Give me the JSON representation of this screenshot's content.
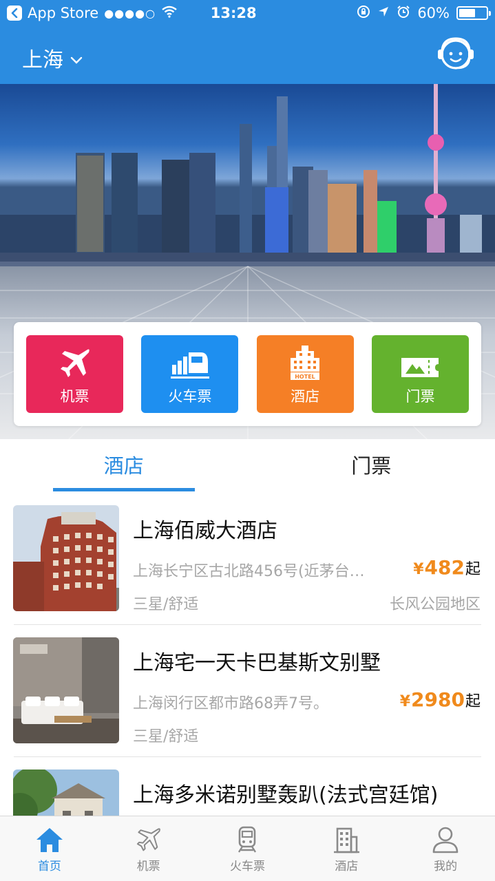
{
  "status_bar": {
    "carrier": "App Store",
    "signal_dots": "●●●●○",
    "time": "13:28",
    "battery_percent": "60%",
    "battery_level": 0.6
  },
  "header": {
    "city": "上海"
  },
  "colors": {
    "brand_blue": "#2b8ce0",
    "flight_tile": "#e8285a",
    "train_tile": "#1e8ff0",
    "hotel_tile": "#f57f26",
    "ticket_tile": "#64b22e",
    "price_orange": "#f08a1c"
  },
  "quick_entries": [
    {
      "label": "机票",
      "icon": "airplane-icon"
    },
    {
      "label": "火车票",
      "icon": "train-icon"
    },
    {
      "label": "酒店",
      "icon": "hotel-icon"
    },
    {
      "label": "门票",
      "icon": "ticket-icon"
    }
  ],
  "hero": {
    "hotel_sign_text": "HOTEL"
  },
  "tabs": [
    {
      "label": "酒店",
      "active": true
    },
    {
      "label": "门票",
      "active": false
    }
  ],
  "hotels": [
    {
      "name": "上海佰威大酒店",
      "address": "上海长宁区古北路456号(近茅台…",
      "price_symbol": "¥",
      "price": "482",
      "price_suffix": "起",
      "grade": "三星/舒适",
      "area": "长风公园地区"
    },
    {
      "name": "上海宅一天卡巴基斯文别墅",
      "address": "上海闵行区都市路68弄7号。",
      "price_symbol": "¥",
      "price": "2980",
      "price_suffix": "起",
      "grade": "三星/舒适",
      "area": ""
    },
    {
      "name": "上海多米诺别墅轰趴(法式宫廷馆)",
      "address": "",
      "price_symbol": "",
      "price": "",
      "price_suffix": "",
      "grade": "",
      "area": ""
    }
  ],
  "tabbar": [
    {
      "label": "首页",
      "icon": "home-icon",
      "active": true
    },
    {
      "label": "机票",
      "icon": "airplane-icon",
      "active": false
    },
    {
      "label": "火车票",
      "icon": "train-icon",
      "active": false
    },
    {
      "label": "酒店",
      "icon": "hotel-building-icon",
      "active": false
    },
    {
      "label": "我的",
      "icon": "user-icon",
      "active": false
    }
  ]
}
